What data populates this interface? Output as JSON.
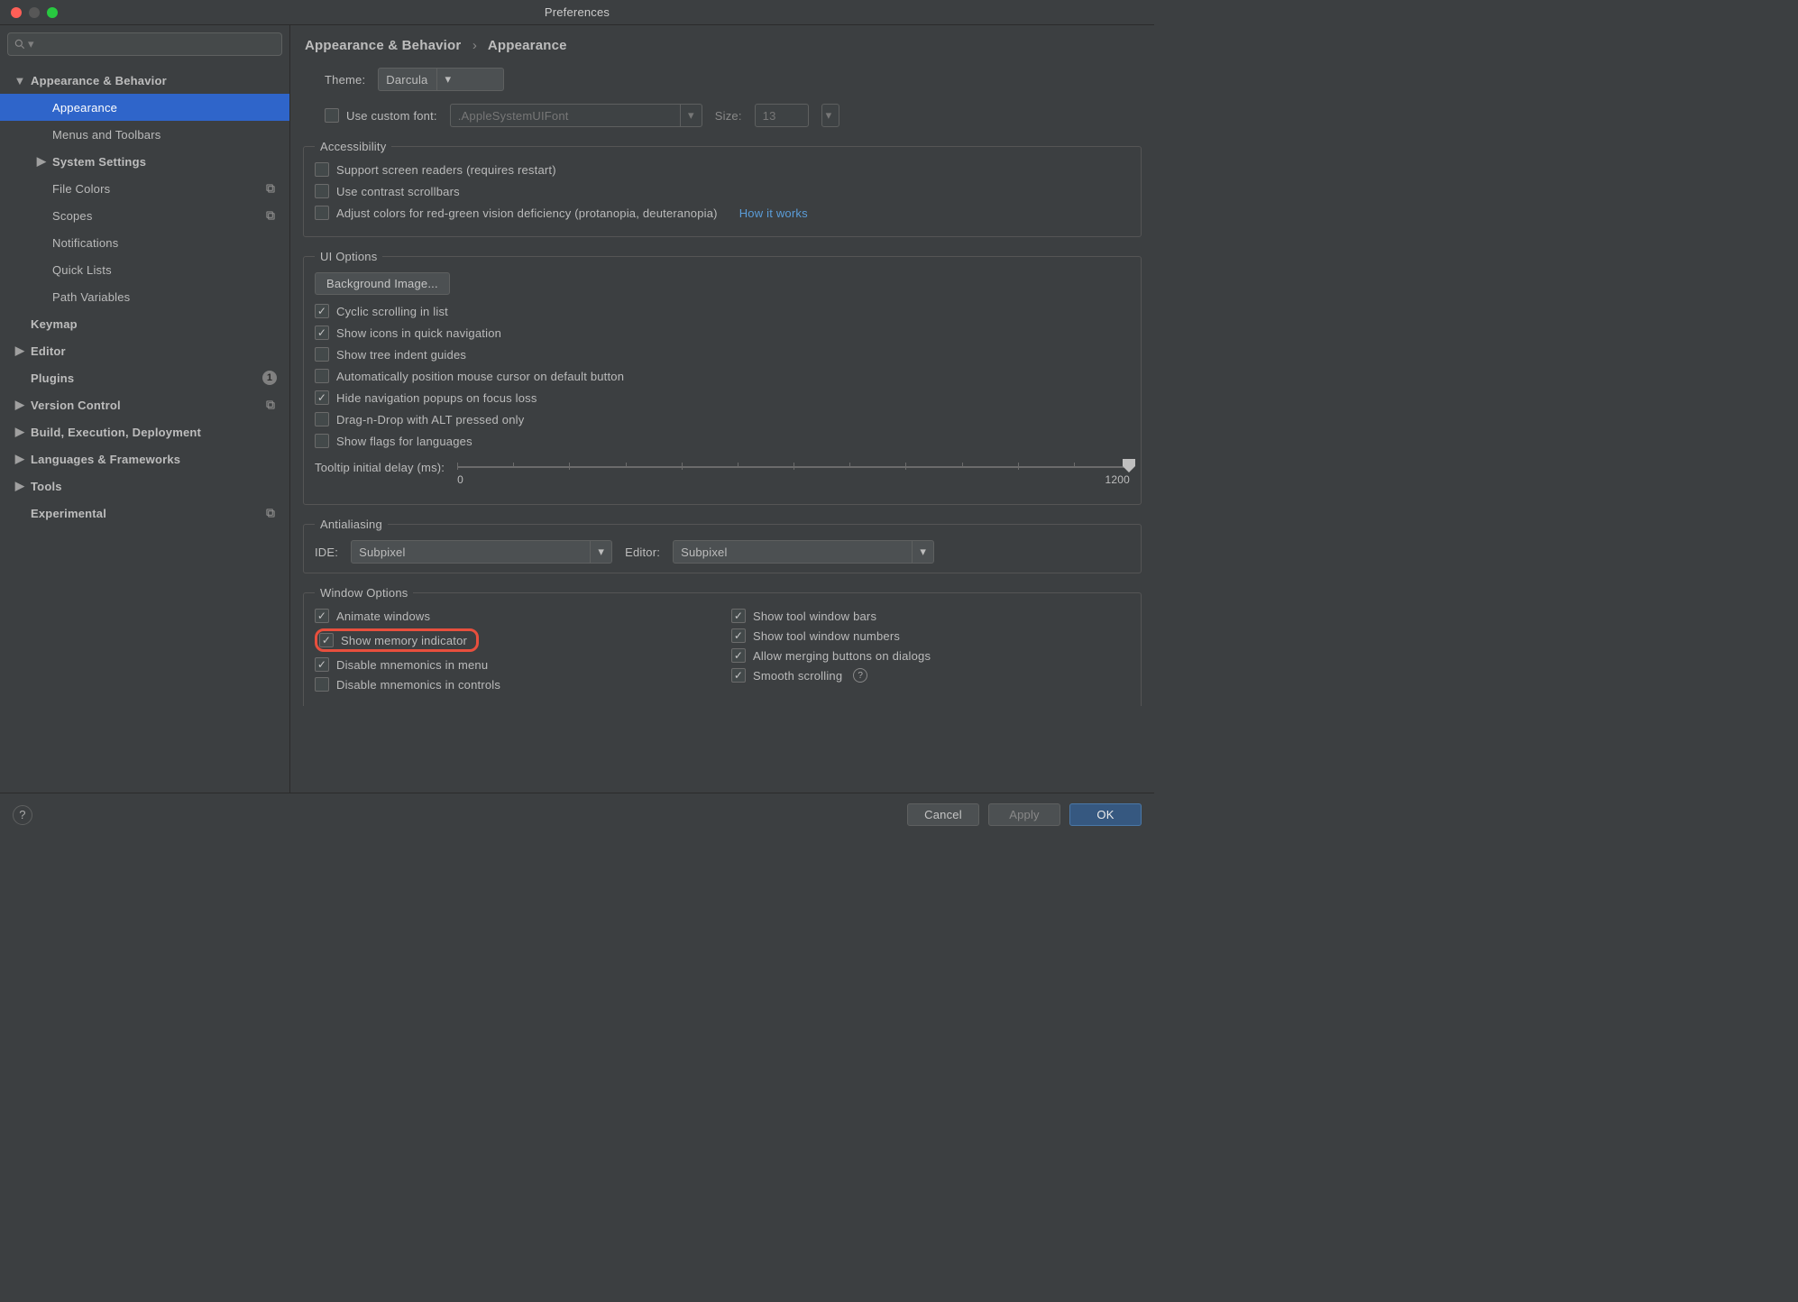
{
  "window": {
    "title": "Preferences"
  },
  "search": {
    "placeholder": ""
  },
  "sidebar": {
    "items": [
      {
        "label": "Appearance & Behavior",
        "level": 0,
        "arrow": "down",
        "bold": true
      },
      {
        "label": "Appearance",
        "level": 2,
        "selected": true
      },
      {
        "label": "Menus and Toolbars",
        "level": 2
      },
      {
        "label": "System Settings",
        "level": 1,
        "arrow": "right",
        "bold": true
      },
      {
        "label": "File Colors",
        "level": 2,
        "trailing": "copy"
      },
      {
        "label": "Scopes",
        "level": 2,
        "trailing": "copy"
      },
      {
        "label": "Notifications",
        "level": 2
      },
      {
        "label": "Quick Lists",
        "level": 2
      },
      {
        "label": "Path Variables",
        "level": 2
      },
      {
        "label": "Keymap",
        "level": 0,
        "bold": true,
        "spacer": true
      },
      {
        "label": "Editor",
        "level": 0,
        "arrow": "right",
        "bold": true
      },
      {
        "label": "Plugins",
        "level": 0,
        "bold": true,
        "spacer": true,
        "badge": "1"
      },
      {
        "label": "Version Control",
        "level": 0,
        "arrow": "right",
        "bold": true,
        "trailing": "copy"
      },
      {
        "label": "Build, Execution, Deployment",
        "level": 0,
        "arrow": "right",
        "bold": true
      },
      {
        "label": "Languages & Frameworks",
        "level": 0,
        "arrow": "right",
        "bold": true
      },
      {
        "label": "Tools",
        "level": 0,
        "arrow": "right",
        "bold": true
      },
      {
        "label": "Experimental",
        "level": 0,
        "bold": true,
        "spacer": true,
        "trailing": "copy"
      }
    ]
  },
  "breadcrumb": {
    "a": "Appearance & Behavior",
    "b": "Appearance"
  },
  "theme": {
    "label": "Theme:",
    "value": "Darcula"
  },
  "customFont": {
    "cbLabel": "Use custom font:",
    "value": ".AppleSystemUIFont",
    "sizeLabel": "Size:",
    "sizeValue": "13"
  },
  "accessibility": {
    "legend": "Accessibility",
    "items": [
      {
        "label": "Support screen readers (requires restart)",
        "checked": false
      },
      {
        "label": "Use contrast scrollbars",
        "checked": false
      }
    ],
    "colorBlind": {
      "label": "Adjust colors for red-green vision deficiency (protanopia, deuteranopia)",
      "link": "How it works",
      "checked": false
    }
  },
  "uiOptions": {
    "legend": "UI Options",
    "bgImage": "Background Image...",
    "items": [
      {
        "label": "Cyclic scrolling in list",
        "checked": true
      },
      {
        "label": "Show icons in quick navigation",
        "checked": true
      },
      {
        "label": "Show tree indent guides",
        "checked": false
      },
      {
        "label": "Automatically position mouse cursor on default button",
        "checked": false
      },
      {
        "label": "Hide navigation popups on focus loss",
        "checked": true
      },
      {
        "label": "Drag-n-Drop with ALT pressed only",
        "checked": false
      },
      {
        "label": "Show flags for languages",
        "checked": false
      }
    ],
    "tooltip": {
      "label": "Tooltip initial delay (ms):",
      "min": "0",
      "max": "1200"
    }
  },
  "antialiasing": {
    "legend": "Antialiasing",
    "ideLabel": "IDE:",
    "ideValue": "Subpixel",
    "editorLabel": "Editor:",
    "editorValue": "Subpixel"
  },
  "windowOptions": {
    "legend": "Window Options",
    "left": [
      {
        "label": "Animate windows",
        "checked": true
      },
      {
        "label": "Show memory indicator",
        "checked": true,
        "highlight": true
      },
      {
        "label": "Disable mnemonics in menu",
        "checked": true
      },
      {
        "label": "Disable mnemonics in controls",
        "checked": false
      }
    ],
    "right": [
      {
        "label": "Show tool window bars",
        "checked": true
      },
      {
        "label": "Show tool window numbers",
        "checked": true
      },
      {
        "label": "Allow merging buttons on dialogs",
        "checked": true
      },
      {
        "label": "Smooth scrolling",
        "checked": true,
        "help": true
      }
    ]
  },
  "footer": {
    "cancel": "Cancel",
    "apply": "Apply",
    "ok": "OK"
  }
}
